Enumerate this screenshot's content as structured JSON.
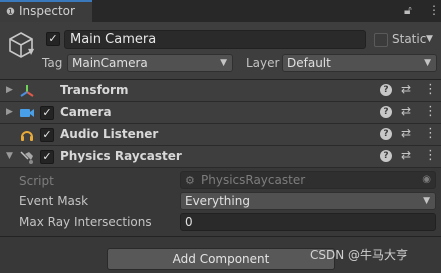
{
  "tab": {
    "label": "Inspector",
    "icon": "info-icon"
  },
  "tab_buttons": {
    "lock_icon": "lock-icon",
    "menu_icon": "kebab-icon"
  },
  "gameobject": {
    "icon": "cube-icon",
    "active": true,
    "name": "Main Camera",
    "static_label": "Static",
    "static_checked": false,
    "tag_label": "Tag",
    "tag_value": "MainCamera",
    "layer_label": "Layer",
    "layer_value": "Default"
  },
  "components": [
    {
      "title": "Transform",
      "icon": "transform-axes-icon",
      "has_checkbox": false,
      "expanded": false
    },
    {
      "title": "Camera",
      "icon": "camera-icon",
      "has_checkbox": true,
      "enabled": true,
      "expanded": false
    },
    {
      "title": "Audio Listener",
      "icon": "headphones-icon",
      "has_checkbox": true,
      "enabled": true,
      "expanded": false
    },
    {
      "title": "Physics Raycaster",
      "icon": "raycaster-icon",
      "has_checkbox": true,
      "enabled": true,
      "expanded": true
    }
  ],
  "raycaster": {
    "script_label": "Script",
    "script_value": "PhysicsRaycaster",
    "event_mask_label": "Event Mask",
    "event_mask_value": "Everything",
    "max_ray_label": "Max Ray Intersections",
    "max_ray_value": "0"
  },
  "add_component_label": "Add Component",
  "watermark": "CSDN @牛马大亨",
  "colors": {
    "accent": "#3a79bb",
    "background": "#383838",
    "header": "#3e3e3e"
  }
}
